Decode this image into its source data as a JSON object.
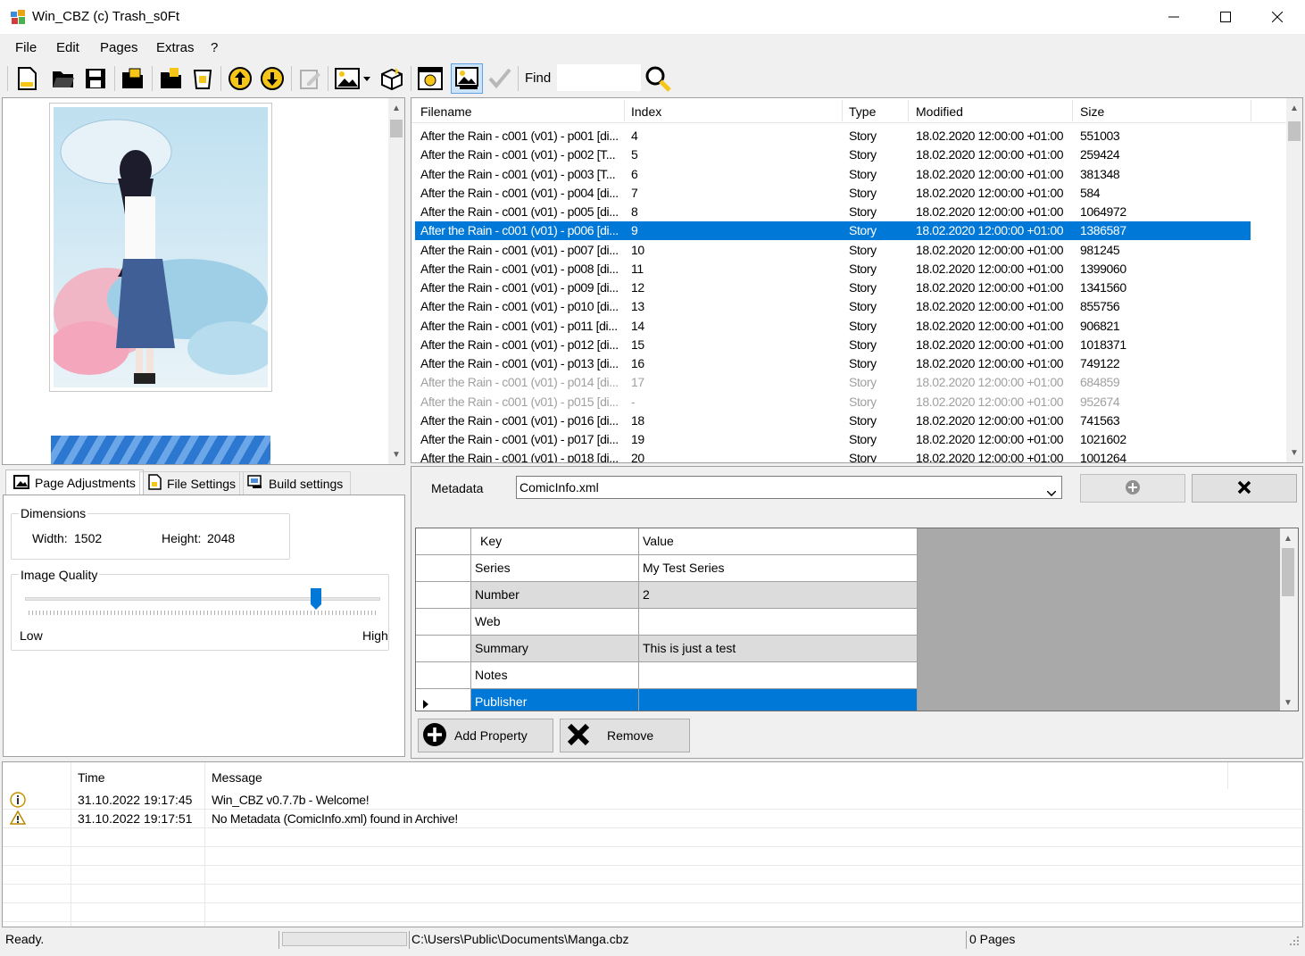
{
  "window": {
    "title": "Win_CBZ (c) Trash_s0Ft"
  },
  "menu": [
    "File",
    "Edit",
    "Pages",
    "Extras",
    "?"
  ],
  "toolbar": {
    "icons": [
      "new-file-icon",
      "open-folder-icon",
      "save-icon",
      "open-archive-icon",
      "add-folder-icon",
      "delete-icon",
      "move-up-icon",
      "move-down-icon",
      "edit-icon",
      "image-icon",
      "package-icon",
      "info-icon",
      "image-view-icon",
      "check-icon"
    ],
    "find_label": "Find",
    "find_value": ""
  },
  "filelist": {
    "columns": [
      "Filename",
      "Index",
      "Type",
      "Modified",
      "Size"
    ],
    "rows": [
      {
        "filename": "After the Rain - c001 (v01) - p001 [di...",
        "index": "4",
        "type": "Story",
        "modified": "18.02.2020 12:00:00 +01:00",
        "size": "551003",
        "state": "normal"
      },
      {
        "filename": "After the Rain - c001 (v01) - p002 [T...",
        "index": "5",
        "type": "Story",
        "modified": "18.02.2020 12:00:00 +01:00",
        "size": "259424",
        "state": "normal"
      },
      {
        "filename": "After the Rain - c001 (v01) - p003 [T...",
        "index": "6",
        "type": "Story",
        "modified": "18.02.2020 12:00:00 +01:00",
        "size": "381348",
        "state": "normal"
      },
      {
        "filename": "After the Rain - c001 (v01) - p004 [di...",
        "index": "7",
        "type": "Story",
        "modified": "18.02.2020 12:00:00 +01:00",
        "size": "584",
        "state": "normal"
      },
      {
        "filename": "After the Rain - c001 (v01) - p005 [di...",
        "index": "8",
        "type": "Story",
        "modified": "18.02.2020 12:00:00 +01:00",
        "size": "1064972",
        "state": "normal"
      },
      {
        "filename": "After the Rain - c001 (v01) - p006 [di...",
        "index": "9",
        "type": "Story",
        "modified": "18.02.2020 12:00:00 +01:00",
        "size": "1386587",
        "state": "selected"
      },
      {
        "filename": "After the Rain - c001 (v01) - p007 [di...",
        "index": "10",
        "type": "Story",
        "modified": "18.02.2020 12:00:00 +01:00",
        "size": "981245",
        "state": "normal"
      },
      {
        "filename": "After the Rain - c001 (v01) - p008 [di...",
        "index": "11",
        "type": "Story",
        "modified": "18.02.2020 12:00:00 +01:00",
        "size": "1399060",
        "state": "normal"
      },
      {
        "filename": "After the Rain - c001 (v01) - p009 [di...",
        "index": "12",
        "type": "Story",
        "modified": "18.02.2020 12:00:00 +01:00",
        "size": "1341560",
        "state": "normal"
      },
      {
        "filename": "After the Rain - c001 (v01) - p010 [di...",
        "index": "13",
        "type": "Story",
        "modified": "18.02.2020 12:00:00 +01:00",
        "size": "855756",
        "state": "normal"
      },
      {
        "filename": "After the Rain - c001 (v01) - p011 [di...",
        "index": "14",
        "type": "Story",
        "modified": "18.02.2020 12:00:00 +01:00",
        "size": "906821",
        "state": "normal"
      },
      {
        "filename": "After the Rain - c001 (v01) - p012 [di...",
        "index": "15",
        "type": "Story",
        "modified": "18.02.2020 12:00:00 +01:00",
        "size": "1018371",
        "state": "normal"
      },
      {
        "filename": "After the Rain - c001 (v01) - p013 [di...",
        "index": "16",
        "type": "Story",
        "modified": "18.02.2020 12:00:00 +01:00",
        "size": "749122",
        "state": "normal"
      },
      {
        "filename": "After the Rain - c001 (v01) - p014 [di...",
        "index": "17",
        "type": "Story",
        "modified": "18.02.2020 12:00:00 +01:00",
        "size": "684859",
        "state": "dim"
      },
      {
        "filename": "After the Rain - c001 (v01) - p015 [di...",
        "index": "-",
        "type": "Story",
        "modified": "18.02.2020 12:00:00 +01:00",
        "size": "952674",
        "state": "dim"
      },
      {
        "filename": "After the Rain - c001 (v01) - p016 [di...",
        "index": "18",
        "type": "Story",
        "modified": "18.02.2020 12:00:00 +01:00",
        "size": "741563",
        "state": "normal"
      },
      {
        "filename": "After the Rain - c001 (v01) - p017 [di...",
        "index": "19",
        "type": "Story",
        "modified": "18.02.2020 12:00:00 +01:00",
        "size": "1021602",
        "state": "normal"
      },
      {
        "filename": "After the Rain - c001 (v01) - p018 [di...",
        "index": "20",
        "type": "Story",
        "modified": "18.02.2020 12:00:00 +01:00",
        "size": "1001264",
        "state": "normal"
      }
    ]
  },
  "tabs": [
    {
      "label": "Page Adjustments",
      "icon": "image-adjust-icon",
      "active": true
    },
    {
      "label": "File Settings",
      "icon": "file-settings-icon",
      "active": false
    },
    {
      "label": "Build settings",
      "icon": "build-settings-icon",
      "active": false
    }
  ],
  "page_adjustments": {
    "dimensions_title": "Dimensions",
    "width_label": "Width:",
    "width_value": "1502",
    "height_label": "Height:",
    "height_value": "2048",
    "quality_title": "Image Quality",
    "quality_level": 0.82,
    "low_label": "Low",
    "high_label": "High"
  },
  "metadata": {
    "label": "Metadata",
    "file_value": "ComicInfo.xml",
    "columns": [
      "Key",
      "Value"
    ],
    "rows": [
      {
        "key": "Series",
        "value": "My Test Series",
        "selected": false
      },
      {
        "key": "Number",
        "value": "2",
        "selected": false
      },
      {
        "key": "Web",
        "value": "",
        "selected": false
      },
      {
        "key": "Summary",
        "value": "This is just a test",
        "selected": false
      },
      {
        "key": "Notes",
        "value": "",
        "selected": false
      },
      {
        "key": "Publisher",
        "value": "",
        "selected": true
      }
    ],
    "add_button": "Add Property",
    "remove_button": "Remove"
  },
  "log": {
    "columns": [
      "Time",
      "Message"
    ],
    "rows": [
      {
        "icon": "info-icon",
        "time": "31.10.2022 19:17:45",
        "message": "Win_CBZ v0.7.7b  - Welcome!"
      },
      {
        "icon": "warning-icon",
        "time": "31.10.2022 19:17:51",
        "message": "No Metadata (ComicInfo.xml) found in Archive!"
      }
    ]
  },
  "status": {
    "text": "Ready.",
    "path": "C:\\Users\\Public\\Documents\\Manga.cbz",
    "pages": "0 Pages"
  },
  "colors": {
    "accent": "#0078d7",
    "dim_text": "#a0a0a0",
    "grid_empty": "#a9a9a9"
  }
}
